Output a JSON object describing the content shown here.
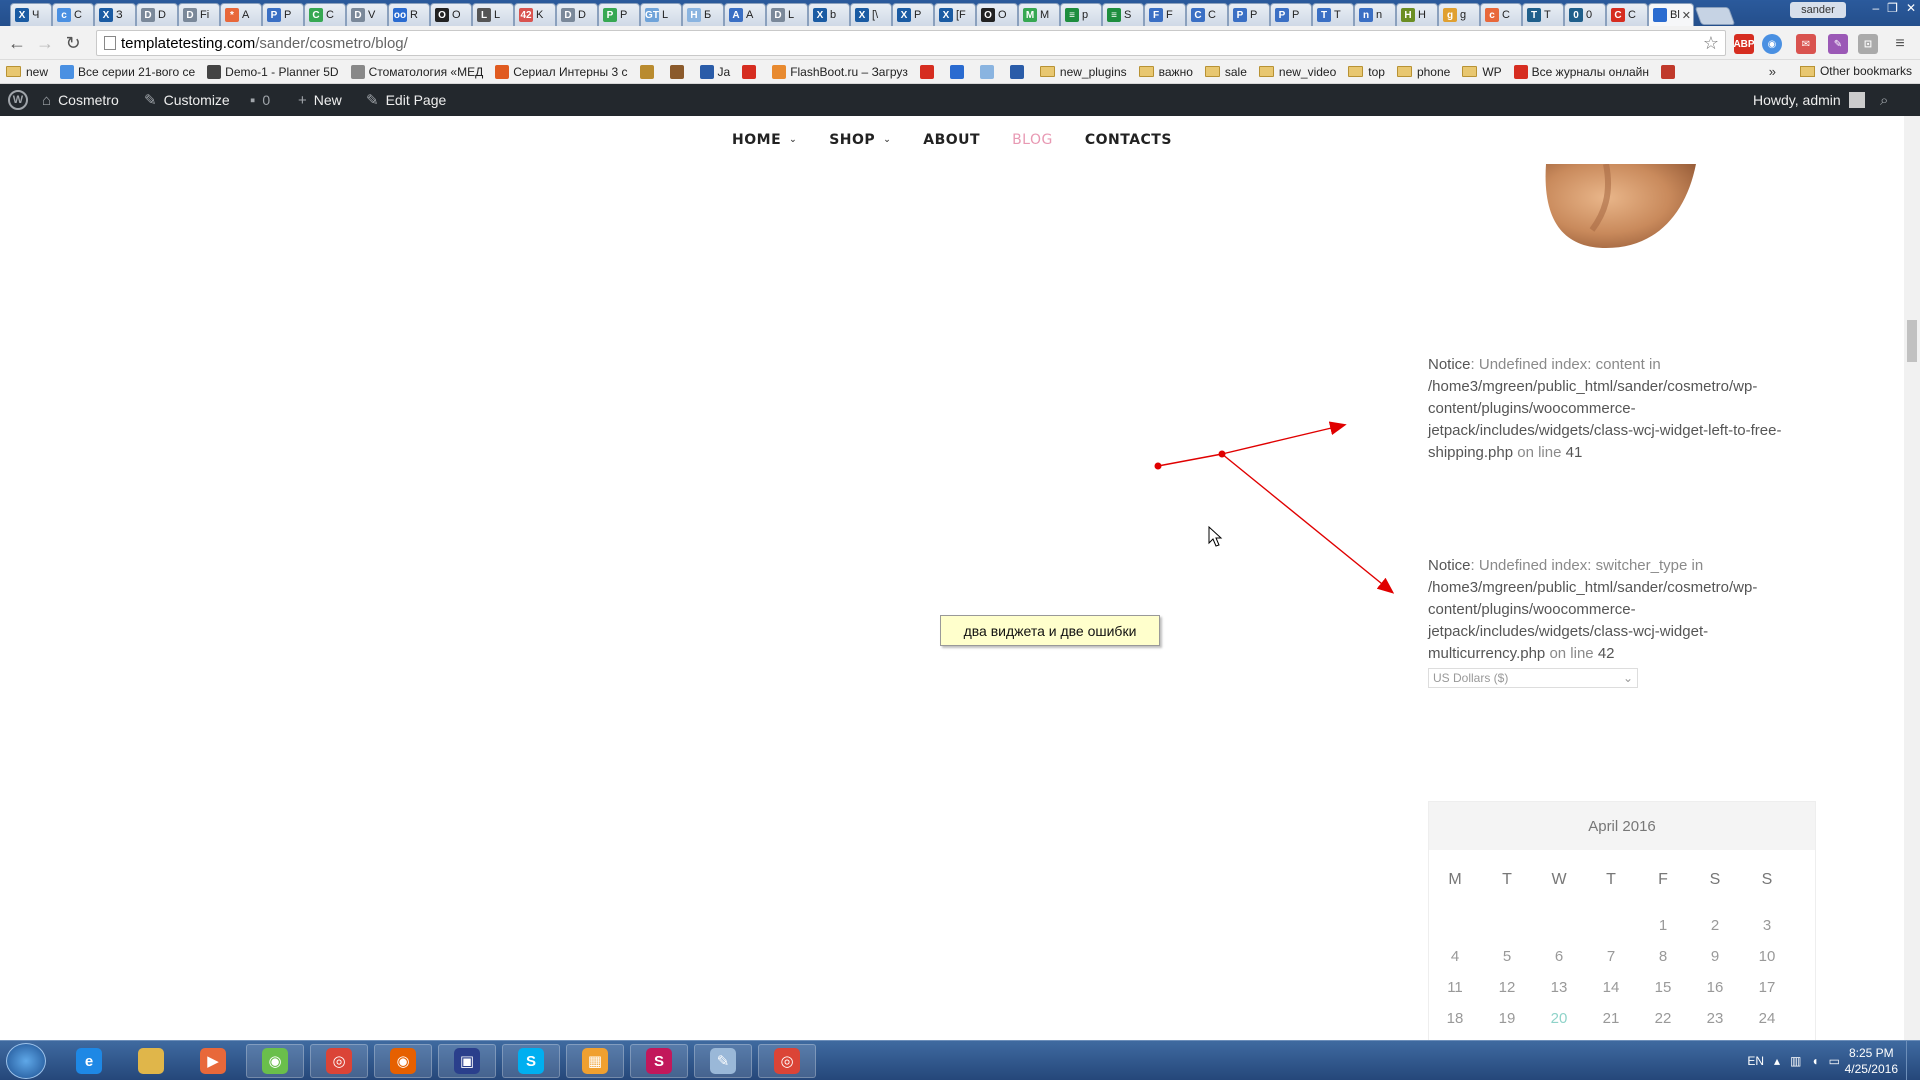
{
  "browser": {
    "tabs": [
      {
        "label": "Ч",
        "color": "#1a5ba3",
        "glyph": "X"
      },
      {
        "label": "C",
        "color": "#4a90e2",
        "glyph": "c"
      },
      {
        "label": "З",
        "color": "#1a5ba3",
        "glyph": "X"
      },
      {
        "label": "D",
        "color": "#7a8899",
        "glyph": "D"
      },
      {
        "label": "Fi",
        "color": "#7a8899",
        "glyph": "D"
      },
      {
        "label": "A",
        "color": "#e8683a",
        "glyph": "*"
      },
      {
        "label": "P",
        "color": "#3a6fc4",
        "glyph": "P"
      },
      {
        "label": "C",
        "color": "#36a852",
        "glyph": "C"
      },
      {
        "label": "V",
        "color": "#7a8899",
        "glyph": "D"
      },
      {
        "label": "R",
        "color": "#2a6bd0",
        "glyph": "oo"
      },
      {
        "label": "O",
        "color": "#222222",
        "glyph": "O"
      },
      {
        "label": "L",
        "color": "#555555",
        "glyph": "L"
      },
      {
        "label": "K",
        "color": "#d9534f",
        "glyph": "42"
      },
      {
        "label": "D",
        "color": "#7a8899",
        "glyph": "D"
      },
      {
        "label": "P",
        "color": "#36a852",
        "glyph": "P"
      },
      {
        "label": "L",
        "color": "#6fa3d9",
        "glyph": "GT"
      },
      {
        "label": "Б",
        "color": "#8ab4e0",
        "glyph": "H"
      },
      {
        "label": "A",
        "color": "#3a6fc4",
        "glyph": "A"
      },
      {
        "label": "L",
        "color": "#7a8899",
        "glyph": "D"
      },
      {
        "label": "b",
        "color": "#1a5ba3",
        "glyph": "X"
      },
      {
        "label": "[\\",
        "color": "#1a5ba3",
        "glyph": "X"
      },
      {
        "label": "P",
        "color": "#1a5ba3",
        "glyph": "X"
      },
      {
        "label": "[F",
        "color": "#1a5ba3",
        "glyph": "X"
      },
      {
        "label": "O",
        "color": "#222222",
        "glyph": "O"
      },
      {
        "label": "M",
        "color": "#36a852",
        "glyph": "M"
      },
      {
        "label": "p",
        "color": "#1e8e3e",
        "glyph": "≡"
      },
      {
        "label": "S",
        "color": "#1e8e3e",
        "glyph": "≡"
      },
      {
        "label": "F",
        "color": "#3a6fc4",
        "glyph": "F"
      },
      {
        "label": "C",
        "color": "#3a6fc4",
        "glyph": "C"
      },
      {
        "label": "P",
        "color": "#3a6fc4",
        "glyph": "P"
      },
      {
        "label": "P",
        "color": "#3a6fc4",
        "glyph": "P"
      },
      {
        "label": "T",
        "color": "#3a6fc4",
        "glyph": "T"
      },
      {
        "label": "n",
        "color": "#3a6fc4",
        "glyph": "n"
      },
      {
        "label": "H",
        "color": "#6b8e23",
        "glyph": "H"
      },
      {
        "label": "g",
        "color": "#e0a030",
        "glyph": "g"
      },
      {
        "label": "C",
        "color": "#e8683a",
        "glyph": "c"
      },
      {
        "label": "T",
        "color": "#1f5f8b",
        "glyph": "T"
      },
      {
        "label": "0",
        "color": "#1f5f8b",
        "glyph": "0"
      },
      {
        "label": "C",
        "color": "#d62d20",
        "glyph": "C"
      }
    ],
    "active_tab": {
      "label": "Bl",
      "close": "✕"
    },
    "profile_name": "sander",
    "window_controls": [
      "–",
      "❐",
      "✕"
    ],
    "url_host": "templatetesting.com",
    "url_path": "/sander/cosmetro/blog/",
    "bookmarks": [
      {
        "label": "new",
        "type": "folder"
      },
      {
        "label": "Все серии 21-вого се",
        "type": "link",
        "color": "#4a90e2"
      },
      {
        "label": "Demo-1 - Planner 5D",
        "type": "link",
        "color": "#444444"
      },
      {
        "label": "Стоматология «МЕД",
        "type": "link",
        "color": "#888888"
      },
      {
        "label": "Сериал Интерны 3 с",
        "type": "link",
        "color": "#e05a1f"
      },
      {
        "label": "",
        "type": "link",
        "color": "#b98b2f"
      },
      {
        "label": "",
        "type": "link",
        "color": "#8b5a2b"
      },
      {
        "label": "Ja",
        "type": "link",
        "color": "#2a5ca8"
      },
      {
        "label": "",
        "type": "link",
        "color": "#d62d20"
      },
      {
        "label": "FlashBoot.ru – Загруз",
        "type": "link",
        "color": "#e88a2f"
      },
      {
        "label": "",
        "type": "link",
        "color": "#d62d20"
      },
      {
        "label": "",
        "type": "link",
        "color": "#2a6bd0"
      },
      {
        "label": "",
        "type": "link",
        "color": "#8ab4e0"
      },
      {
        "label": "",
        "type": "link",
        "color": "#2a5ca8"
      },
      {
        "label": "new_plugins",
        "type": "folder"
      },
      {
        "label": "важно",
        "type": "folder"
      },
      {
        "label": "sale",
        "type": "folder"
      },
      {
        "label": "new_video",
        "type": "folder"
      },
      {
        "label": "top",
        "type": "folder"
      },
      {
        "label": "phone",
        "type": "folder"
      },
      {
        "label": "WP",
        "type": "folder"
      },
      {
        "label": "Все журналы онлайн",
        "type": "link",
        "color": "#d62d20"
      },
      {
        "label": "",
        "type": "link",
        "color": "#c0392b"
      }
    ],
    "bookmarks_more": "»",
    "other_bookmarks": "Other bookmarks"
  },
  "adminbar": {
    "site_name": "Cosmetro",
    "customize": "Customize",
    "comments_count": "0",
    "new_label": "New",
    "edit_page": "Edit Page",
    "howdy": "Howdy, admin"
  },
  "site_nav": {
    "items": [
      {
        "label": "HOME",
        "has_dropdown": true,
        "active": false
      },
      {
        "label": "SHOP",
        "has_dropdown": true,
        "active": false
      },
      {
        "label": "ABOUT",
        "has_dropdown": false,
        "active": false
      },
      {
        "label": "BLOG",
        "has_dropdown": false,
        "active": true
      },
      {
        "label": "CONTACTS",
        "has_dropdown": false,
        "active": false
      }
    ],
    "active_color": "#e899b3"
  },
  "notices": [
    {
      "label": "Notice",
      "message": ": Undefined index: content in",
      "path": "/home3/mgreen/public_html/sander/cosmetro/wp-content/plugins/woocommerce-jetpack/includes/widgets/class-wcj-widget-left-to-free-shipping.php",
      "line_text": " on line ",
      "line": "41"
    },
    {
      "label": "Notice",
      "message": ": Undefined index: switcher_type in",
      "path": "/home3/mgreen/public_html/sander/cosmetro/wp-content/plugins/woocommerce-jetpack/includes/widgets/class-wcj-widget-multicurrency.php",
      "line_text": " on line ",
      "line": "42"
    }
  ],
  "currency_select": {
    "value": "US Dollars ($)"
  },
  "annotation": {
    "text": "два виджета и две ошибки",
    "arrow_color": "#e00000"
  },
  "calendar": {
    "caption": "April 2016",
    "weekdays": [
      "M",
      "T",
      "W",
      "T",
      "F",
      "S",
      "S"
    ],
    "weeks": [
      [
        "",
        "",
        "",
        "",
        "1",
        "2",
        "3"
      ],
      [
        "4",
        "5",
        "6",
        "7",
        "8",
        "9",
        "10"
      ],
      [
        "11",
        "12",
        "13",
        "14",
        "15",
        "16",
        "17"
      ],
      [
        "18",
        "19",
        "20",
        "21",
        "22",
        "23",
        "24"
      ]
    ],
    "today": "20",
    "today_color": "#8fd3c9"
  },
  "scroll_top": {
    "icon": "chevron-up-icon",
    "color": "#f7a1b9"
  },
  "taskbar": {
    "apps": [
      {
        "name": "internet-explorer",
        "color": "#1e88e5",
        "glyph": "e",
        "open": false
      },
      {
        "name": "file-explorer",
        "color": "#e0b64a",
        "glyph": "",
        "open": false
      },
      {
        "name": "media-player",
        "color": "#e8683a",
        "glyph": "▶",
        "open": false
      },
      {
        "name": "network-app",
        "color": "#6abf4b",
        "glyph": "◉",
        "open": true
      },
      {
        "name": "chrome",
        "color": "#db4437",
        "glyph": "◎",
        "open": true
      },
      {
        "name": "firefox",
        "color": "#e66000",
        "glyph": "◉",
        "open": true
      },
      {
        "name": "save-app",
        "color": "#2a3f8c",
        "glyph": "▣",
        "open": true
      },
      {
        "name": "skype",
        "color": "#00aff0",
        "glyph": "S",
        "open": true
      },
      {
        "name": "photo-app",
        "color": "#f0a030",
        "glyph": "▦",
        "open": true
      },
      {
        "name": "s-app",
        "color": "#c2185b",
        "glyph": "S",
        "open": true
      },
      {
        "name": "notes-app",
        "color": "#9ab8d8",
        "glyph": "✎",
        "open": true
      },
      {
        "name": "chrome-2",
        "color": "#db4437",
        "glyph": "◎",
        "open": true
      }
    ],
    "language": "EN",
    "time": "8:25 PM",
    "date": "4/25/2016"
  }
}
